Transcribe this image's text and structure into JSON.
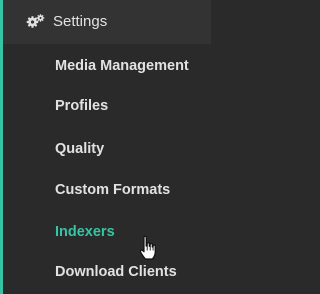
{
  "section": {
    "title": "Settings",
    "icon": "gears-icon"
  },
  "items": [
    {
      "label": "Media Management"
    },
    {
      "label": "Profiles"
    },
    {
      "label": "Quality"
    },
    {
      "label": "Custom Formats"
    },
    {
      "label": "Indexers",
      "active": true
    },
    {
      "label": "Download Clients"
    }
  ],
  "colors": {
    "background": "#2a2a2a",
    "header_background": "#333333",
    "text": "#e1e2e3",
    "accent": "#35c5a4"
  }
}
